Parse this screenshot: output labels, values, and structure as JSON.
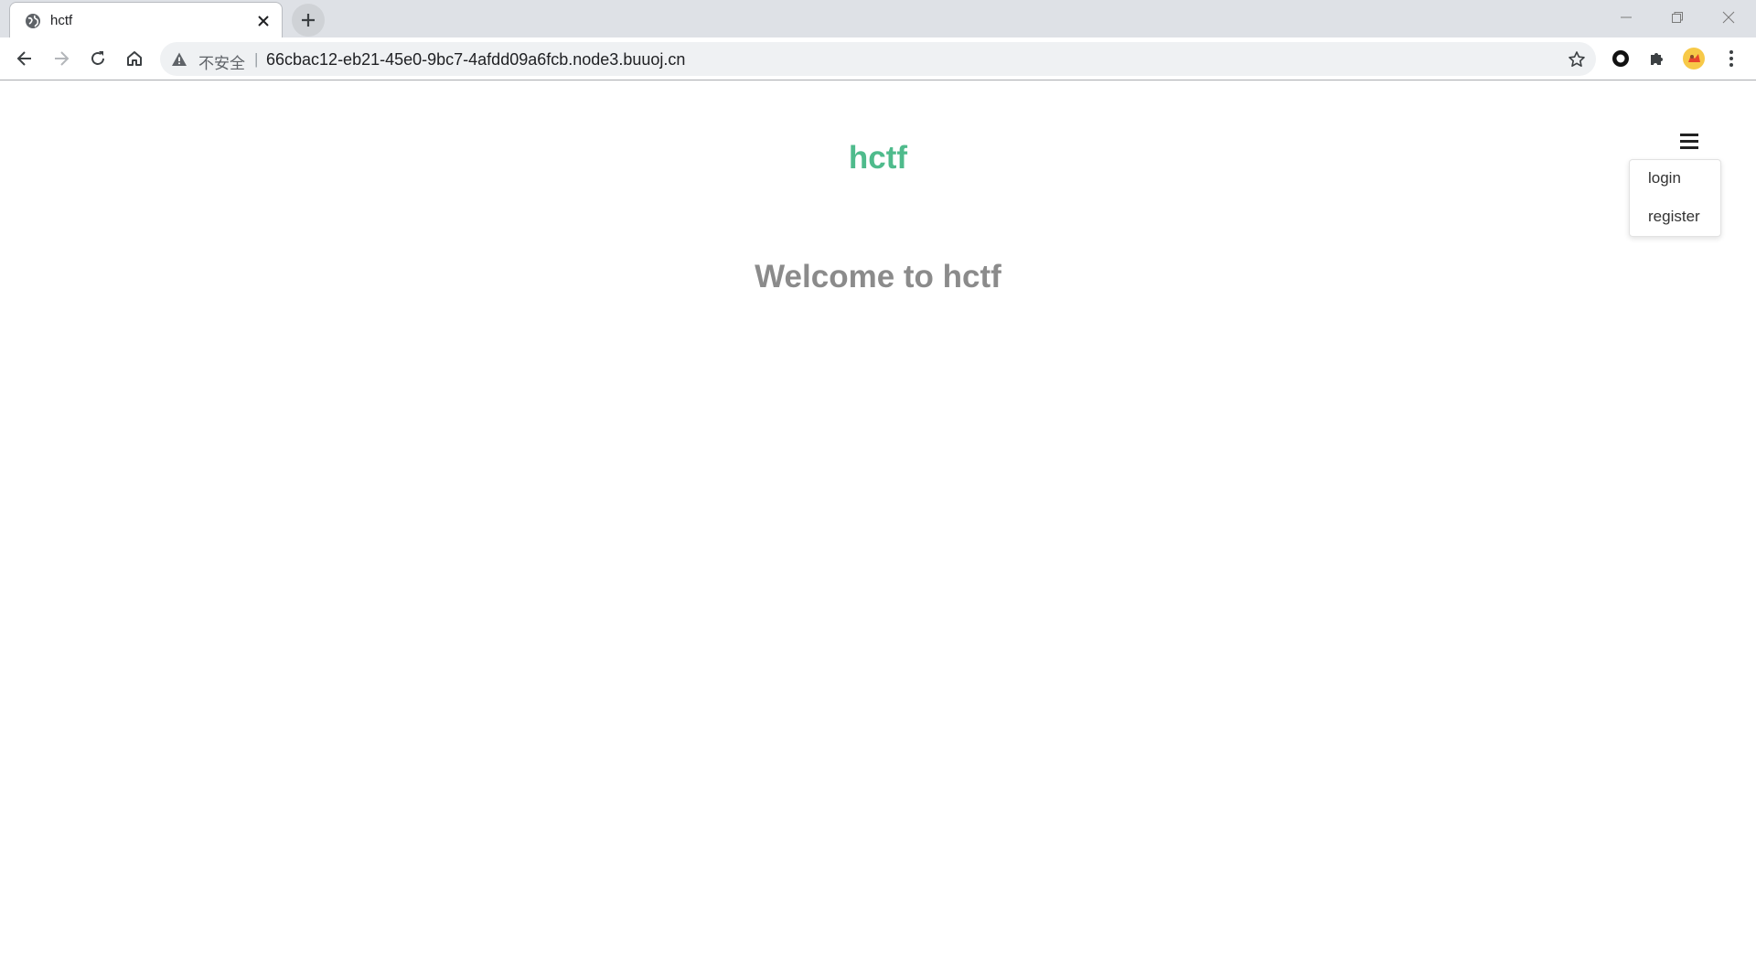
{
  "browser": {
    "tab": {
      "title": "hctf"
    },
    "address_bar": {
      "security_label": "不安全",
      "separator": "|",
      "url": "66cbac12-eb21-45e0-9bc7-4afdd09a6fcb.node3.buuoj.cn"
    }
  },
  "page": {
    "brand": "hctf",
    "welcome": "Welcome to hctf",
    "menu": {
      "items": [
        {
          "label": "login"
        },
        {
          "label": "register"
        }
      ]
    }
  },
  "colors": {
    "brand": "#4fbb8c",
    "welcome_text": "#8b8b8b"
  },
  "icons": {
    "tab_favicon": "globe-icon",
    "tab_close": "close-icon",
    "new_tab": "plus-icon",
    "back": "arrow-left-icon",
    "forward": "arrow-right-icon",
    "reload": "reload-icon",
    "home": "home-icon",
    "warning": "warning-icon",
    "bookmark": "star-icon",
    "extension_circle": "circle-extension-icon",
    "extensions": "puzzle-icon",
    "profile": "avatar-icon",
    "browser_menu": "kebab-menu-icon",
    "page_menu": "hamburger-icon"
  }
}
